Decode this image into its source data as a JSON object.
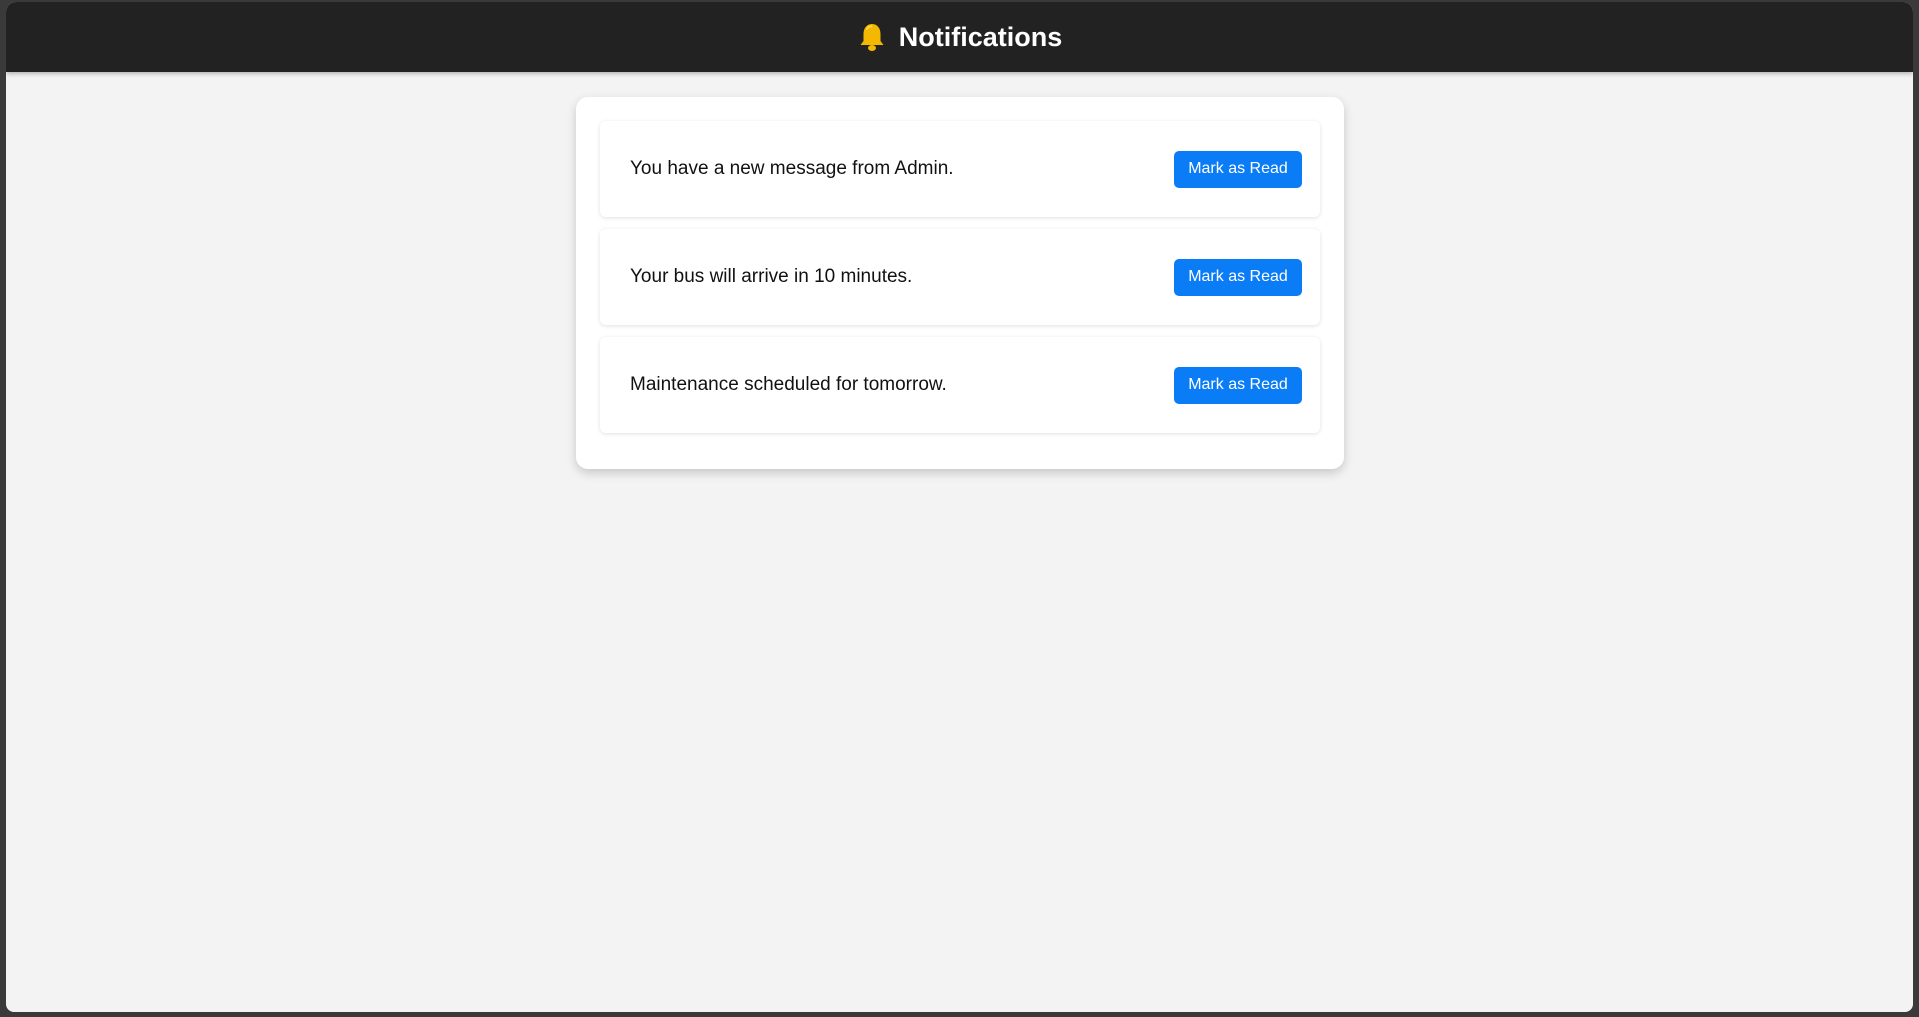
{
  "header": {
    "icon": "bell-icon",
    "title": "Notifications"
  },
  "notifications": [
    {
      "text": "You have a new message from Admin.",
      "action_label": "Mark as Read"
    },
    {
      "text": "Your bus will arrive in 10 minutes.",
      "action_label": "Mark as Read"
    },
    {
      "text": "Maintenance scheduled for tomorrow.",
      "action_label": "Mark as Read"
    }
  ],
  "colors": {
    "header_bg": "#222222",
    "page_bg": "#f3f3f3",
    "button_bg": "#0a7cf6",
    "bell": "#f5b800"
  }
}
